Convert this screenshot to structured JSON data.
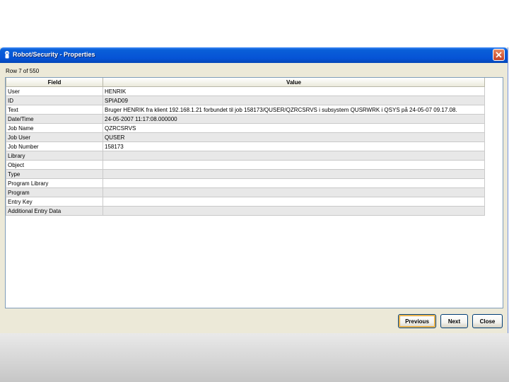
{
  "window": {
    "title": "Robot/Security - Properties"
  },
  "row_counter": "Row 7 of 550",
  "table": {
    "columns": [
      "Field",
      "Value"
    ],
    "rows": [
      {
        "field": "User",
        "value": "HENRIK"
      },
      {
        "field": "ID",
        "value": "SPIAD09"
      },
      {
        "field": "Text",
        "value": "Bruger HENRIK fra klient 192.168.1.21 forbundet til job 158173/QUSER/QZRCSRVS i subsystem QUSRWRK i QSYS på 24-05-07 09.17.08."
      },
      {
        "field": "Date/Time",
        "value": "24-05-2007 11:17:08.000000"
      },
      {
        "field": "Job Name",
        "value": "QZRCSRVS"
      },
      {
        "field": "Job User",
        "value": "QUSER"
      },
      {
        "field": "Job Number",
        "value": "158173"
      },
      {
        "field": "Library",
        "value": ""
      },
      {
        "field": "Object",
        "value": ""
      },
      {
        "field": "Type",
        "value": ""
      },
      {
        "field": "Program Library",
        "value": ""
      },
      {
        "field": "Program",
        "value": ""
      },
      {
        "field": "Entry Key",
        "value": ""
      },
      {
        "field": "Additional Entry Data",
        "value": ""
      }
    ]
  },
  "buttons": {
    "previous": "Previous",
    "next": "Next",
    "close": "Close"
  },
  "icons": {
    "title": "robot-app-icon",
    "close": "close-x-icon"
  },
  "colors": {
    "titlebar": "#0653d6",
    "dialog_bg": "#ece9d8",
    "close_button": "#c4432a"
  }
}
